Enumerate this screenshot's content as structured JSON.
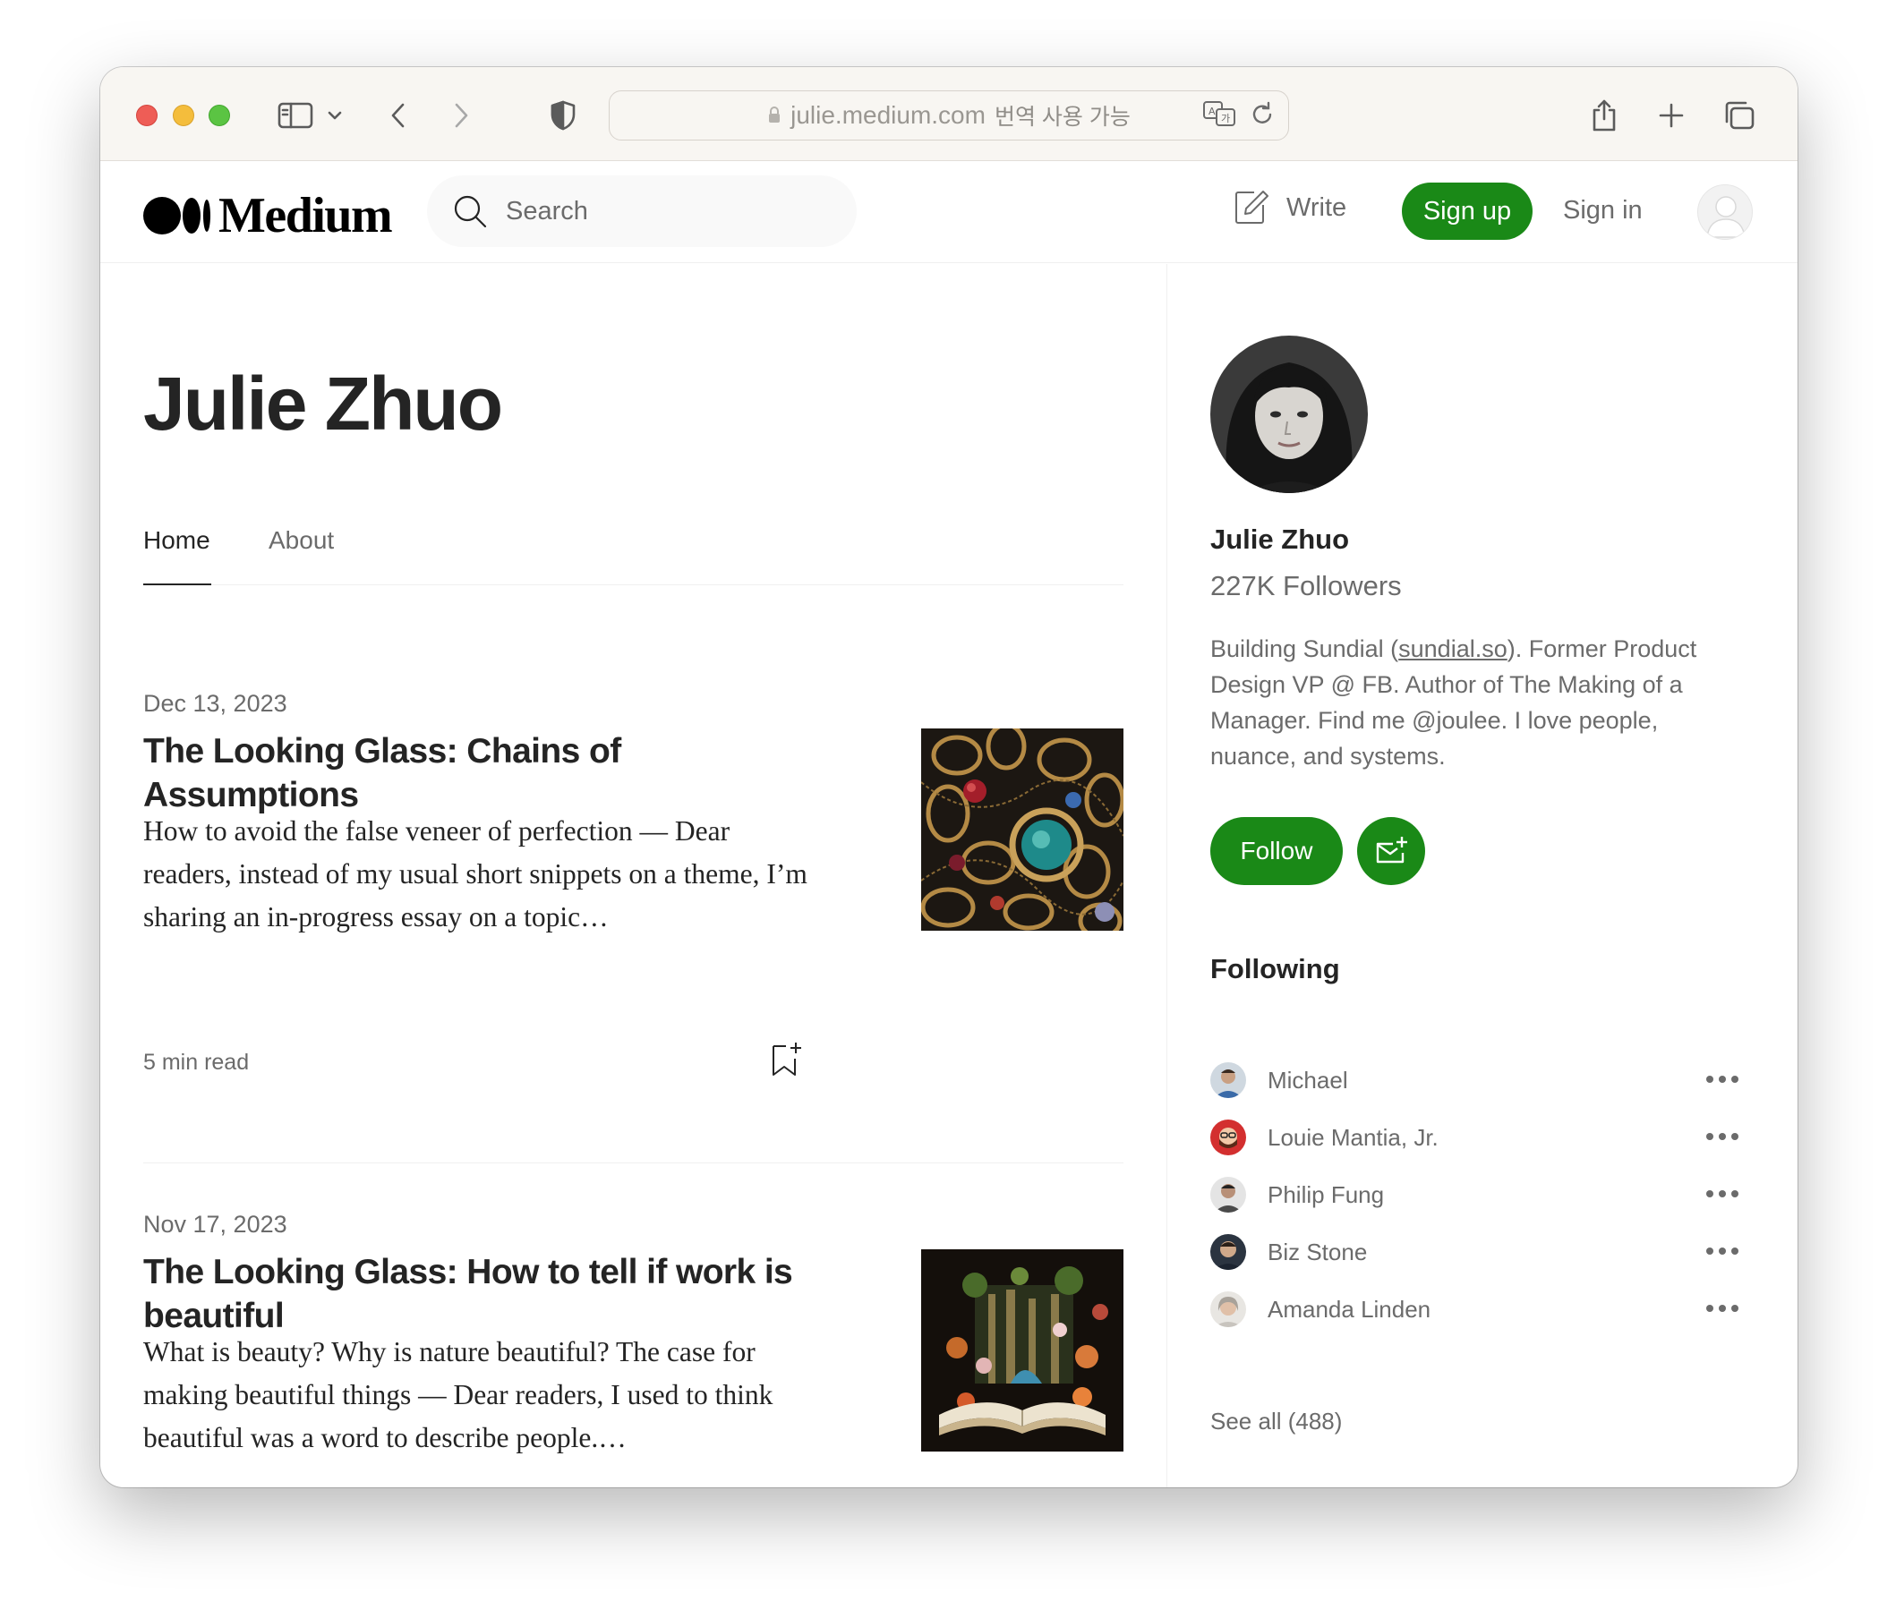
{
  "browser": {
    "url": "julie.medium.com",
    "translate_banner": "번역 사용 가능"
  },
  "header": {
    "logo_text": "Medium",
    "search_placeholder": "Search",
    "write_label": "Write",
    "signup_label": "Sign up",
    "signin_label": "Sign in"
  },
  "profile": {
    "title": "Julie Zhuo",
    "tabs": [
      {
        "label": "Home",
        "active": true
      },
      {
        "label": "About",
        "active": false
      }
    ]
  },
  "posts": [
    {
      "date": "Dec 13, 2023",
      "title": "The Looking Glass: Chains of Assumptions",
      "subtitle": "How to avoid the false veneer of perfection — Dear readers, instead of my usual short snippets on a theme, I’m sharing an in-progress essay on a topic…",
      "read_time": "5 min read"
    },
    {
      "date": "Nov 17, 2023",
      "title": "The Looking Glass: How to tell if work is beautiful",
      "subtitle": "What is beauty? Why is nature beautiful? The case for making beautiful things — Dear readers, I used to think beautiful was a word to describe people.…",
      "read_time": ""
    }
  ],
  "sidebar": {
    "name": "Julie Zhuo",
    "followers": "227K Followers",
    "bio_before": "Building Sundial (",
    "bio_link": "sundial.so",
    "bio_after": "). Former Product Design VP @ FB. Author of The Making of a Manager. Find me @joulee. I love people, nuance, and systems.",
    "follow_label": "Follow",
    "following_title": "Following",
    "following": [
      {
        "name": "Michael"
      },
      {
        "name": "Louie Mantia, Jr."
      },
      {
        "name": "Philip Fung"
      },
      {
        "name": "Biz Stone"
      },
      {
        "name": "Amanda Linden"
      }
    ],
    "see_all": "See all (488)"
  },
  "colors": {
    "accent_green": "#1a8917",
    "text_primary": "#242424",
    "text_secondary": "#6b6b6b"
  }
}
